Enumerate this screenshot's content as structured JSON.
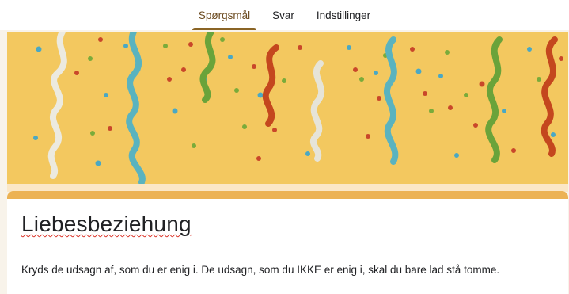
{
  "tabs": [
    {
      "label": "Spørgsmål",
      "active": true
    },
    {
      "label": "Svar",
      "active": false
    },
    {
      "label": "Indstillinger",
      "active": false
    }
  ],
  "header": {
    "image": "confetti-streamers-banner",
    "colors": {
      "background": "#f3c85f",
      "accent": "#ecb254"
    }
  },
  "form": {
    "title": "Liebesbeziehung",
    "description": "Kryds de udsagn af, som du er enig i. De udsagn, som du IKKE er enig i, skal du bare lad stå tomme."
  }
}
